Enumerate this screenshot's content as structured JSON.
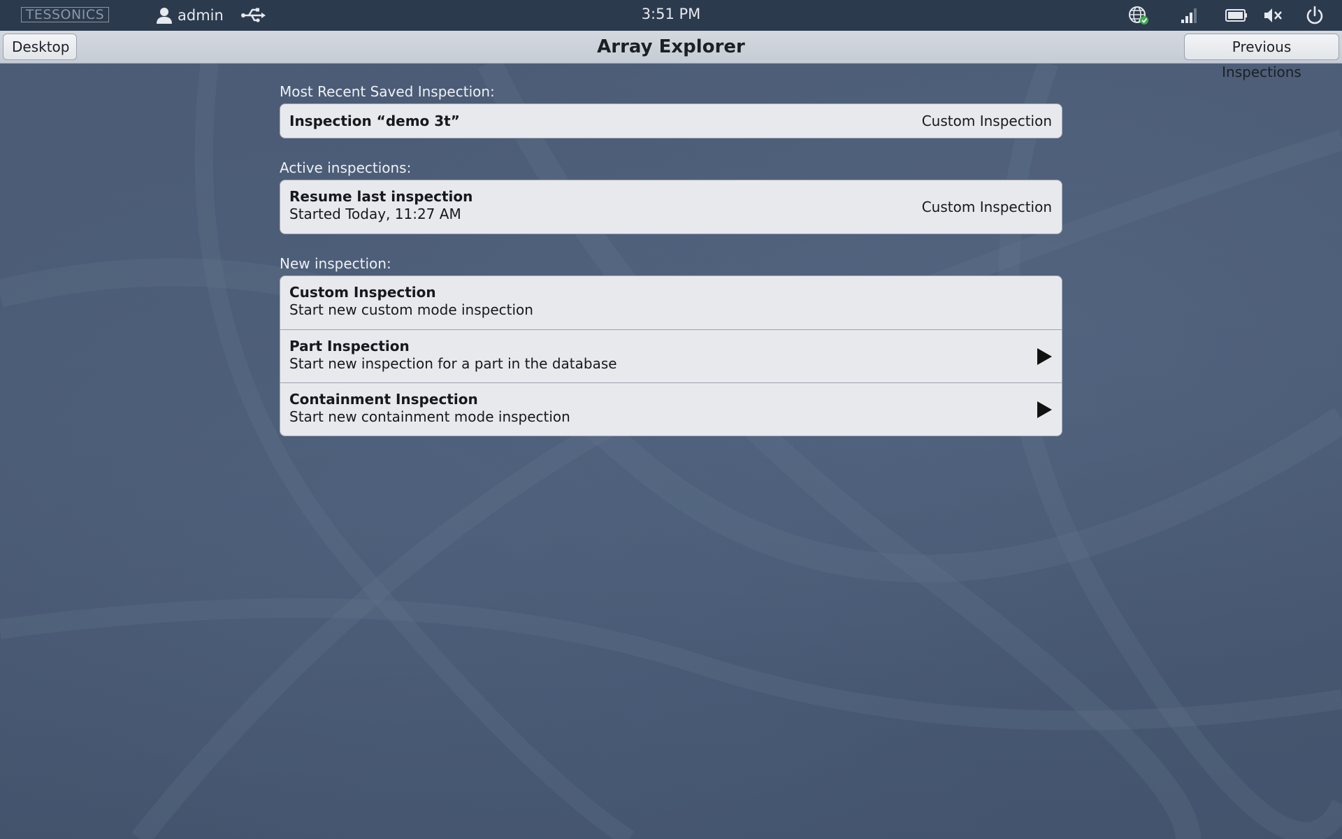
{
  "statusbar": {
    "logo_text": "TESSONICS",
    "user_name": "admin",
    "clock": "3:51 PM",
    "icons": [
      "user-icon",
      "usb-icon",
      "network-globe-icon",
      "signal-icon",
      "battery-icon",
      "speaker-muted-icon",
      "power-icon"
    ]
  },
  "titlebar": {
    "title": "Array Explorer",
    "back_label": "Desktop",
    "forward_label": "Previous Inspections"
  },
  "sections": {
    "recent": {
      "label": "Most Recent Saved Inspection:",
      "item": {
        "title": "Inspection “demo 3t”",
        "mode": "Custom Inspection"
      }
    },
    "active": {
      "label": "Active inspections:",
      "item": {
        "title": "Resume last inspection",
        "subtitle": "Started Today, 11:27 AM",
        "mode": "Custom Inspection"
      }
    },
    "new": {
      "label": "New inspection:",
      "items": [
        {
          "title": "Custom Inspection",
          "subtitle": "Start new custom mode inspection"
        },
        {
          "title": "Part Inspection",
          "subtitle": "Start new inspection for a part in the database"
        },
        {
          "title": "Containment Inspection",
          "subtitle": "Start new containment mode inspection"
        }
      ]
    }
  },
  "colors": {
    "statusbar_bg": "#2c3a4e",
    "background": "#4a5a74",
    "card_bg": "#e8e9ed",
    "network_ok": "#3fae49"
  }
}
